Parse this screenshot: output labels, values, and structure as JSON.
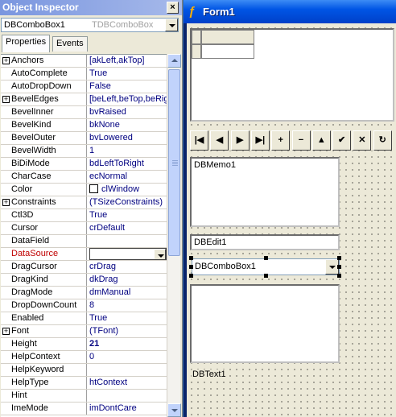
{
  "inspector": {
    "title": "Object Inspector",
    "close_glyph": "×",
    "selected_component": "DBComboBox1",
    "selected_type": "TDBComboBox",
    "tabs": [
      {
        "label": "Properties",
        "active": true
      },
      {
        "label": "Events",
        "active": false
      }
    ],
    "properties": [
      {
        "name": "Anchors",
        "value": "[akLeft,akTop]",
        "expandable": true
      },
      {
        "name": "AutoComplete",
        "value": "True"
      },
      {
        "name": "AutoDropDown",
        "value": "False"
      },
      {
        "name": "BevelEdges",
        "value": "[beLeft,beTop,beRig",
        "expandable": true
      },
      {
        "name": "BevelInner",
        "value": "bvRaised"
      },
      {
        "name": "BevelKind",
        "value": "bkNone"
      },
      {
        "name": "BevelOuter",
        "value": "bvLowered"
      },
      {
        "name": "BevelWidth",
        "value": "1"
      },
      {
        "name": "BiDiMode",
        "value": "bdLeftToRight"
      },
      {
        "name": "CharCase",
        "value": "ecNormal"
      },
      {
        "name": "Color",
        "value": "clWindow",
        "swatch": "#ffffff"
      },
      {
        "name": "Constraints",
        "value": "(TSizeConstraints)",
        "expandable": true
      },
      {
        "name": "Ctl3D",
        "value": "True"
      },
      {
        "name": "Cursor",
        "value": "crDefault"
      },
      {
        "name": "DataField",
        "value": ""
      },
      {
        "name": "DataSource",
        "value": "",
        "selected": true
      },
      {
        "name": "DragCursor",
        "value": "crDrag"
      },
      {
        "name": "DragKind",
        "value": "dkDrag"
      },
      {
        "name": "DragMode",
        "value": "dmManual"
      },
      {
        "name": "DropDownCount",
        "value": "8"
      },
      {
        "name": "Enabled",
        "value": "True"
      },
      {
        "name": "Font",
        "value": "(TFont)",
        "expandable": true
      },
      {
        "name": "Height",
        "value": "21",
        "bold": true
      },
      {
        "name": "HelpContext",
        "value": "0"
      },
      {
        "name": "HelpKeyword",
        "value": ""
      },
      {
        "name": "HelpType",
        "value": "htContext"
      },
      {
        "name": "Hint",
        "value": ""
      },
      {
        "name": "ImeMode",
        "value": "imDontCare"
      }
    ]
  },
  "form": {
    "title": "Form1",
    "navigator_buttons": [
      {
        "name": "first",
        "glyph": "|◀"
      },
      {
        "name": "prior",
        "glyph": "◀"
      },
      {
        "name": "next",
        "glyph": "▶"
      },
      {
        "name": "last",
        "glyph": "▶|"
      },
      {
        "name": "insert",
        "glyph": "+"
      },
      {
        "name": "delete",
        "glyph": "−"
      },
      {
        "name": "edit",
        "glyph": "▲"
      },
      {
        "name": "post",
        "glyph": "✔"
      },
      {
        "name": "cancel",
        "glyph": "✕"
      },
      {
        "name": "refresh",
        "glyph": "↻"
      }
    ],
    "dbmemo_text": "DBMemo1",
    "dbedit_text": "DBEdit1",
    "dbcombo_text": "DBComboBox1",
    "dbtext_text": "DBText1"
  }
}
